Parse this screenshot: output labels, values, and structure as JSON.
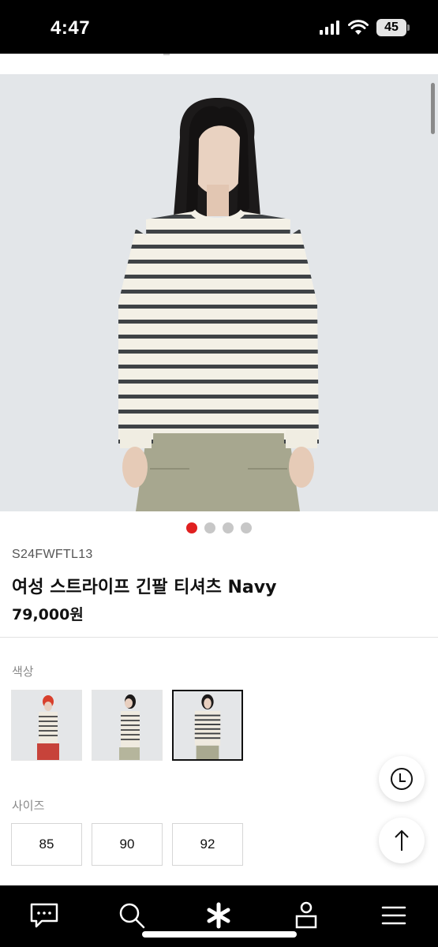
{
  "status_bar": {
    "time": "4:47",
    "battery": "45"
  },
  "product": {
    "sku": "S24FWFTL13",
    "name": "여성 스트라이프 긴팔 티셔츠 Navy",
    "price": "79,000원",
    "image_count": 4,
    "active_image_index": 0
  },
  "options": {
    "color_label": "색상",
    "color_count": 3,
    "selected_color_index": 2,
    "size_label": "사이즈",
    "sizes": [
      "85",
      "90",
      "92"
    ]
  },
  "floating_buttons": [
    "recent-history-icon",
    "scroll-top-arrow-icon"
  ],
  "bottom_nav": [
    "chat-icon",
    "search-icon",
    "asterisk-icon",
    "user-icon",
    "menu-icon"
  ],
  "colors": {
    "accent": "#e02020",
    "nav_bg": "#000000",
    "image_bg": "#e3e6e9"
  }
}
